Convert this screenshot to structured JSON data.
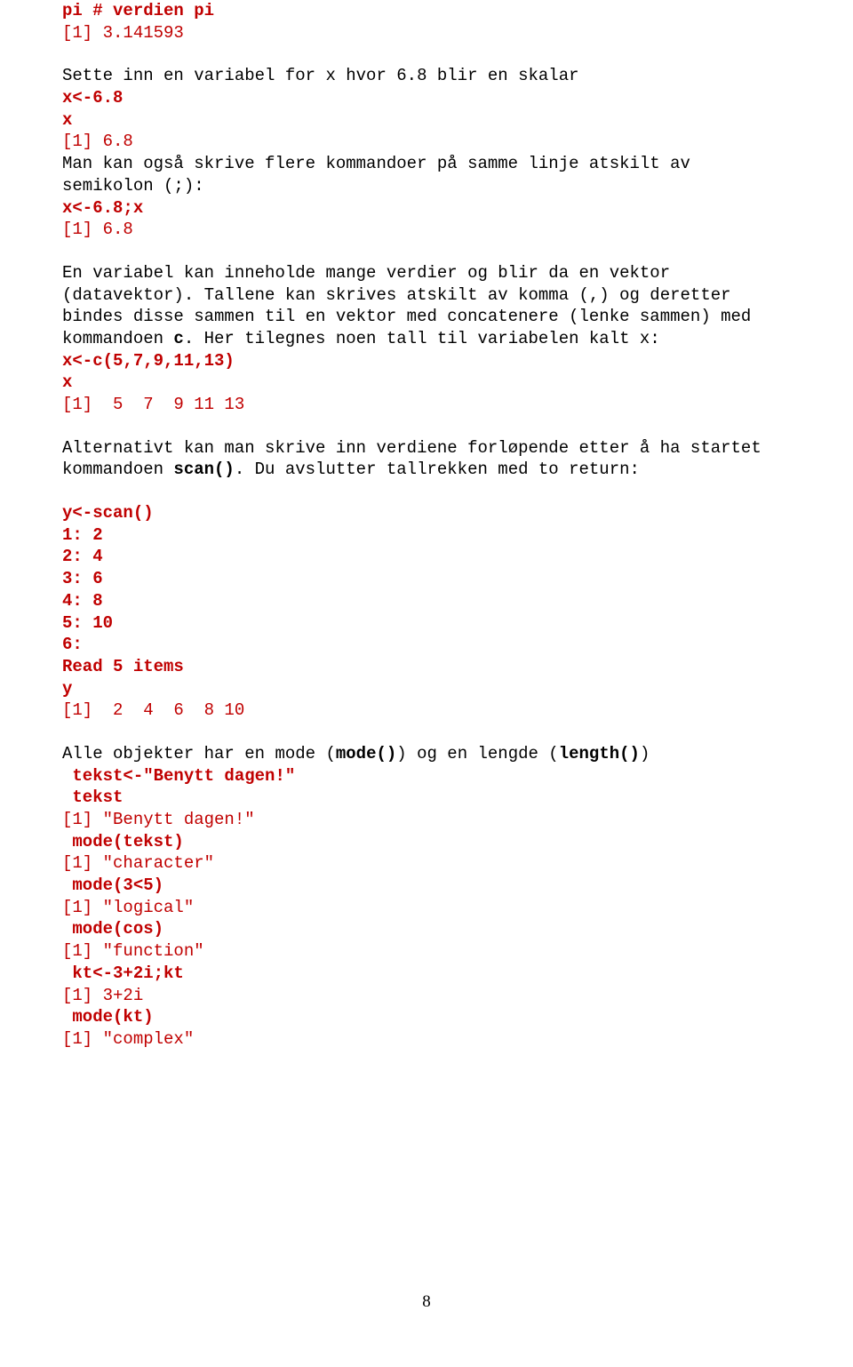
{
  "l1": "pi # verdien pi",
  "l2": "[1] 3.141593",
  "l3": "Sette inn en variabel for x hvor 6.8 blir en skalar",
  "l4": "x<-6.8",
  "l5": "x",
  "l6": "[1] 6.8",
  "l7": "Man kan også skrive flere kommandoer på samme linje atskilt av semikolon (;):",
  "l8": "x<-6.8;x",
  "l9": "[1] 6.8",
  "l10a": "En variabel kan inneholde mange verdier og blir da en vektor (datavektor). Tallene kan skrives atskilt av komma (,) og deretter bindes disse sammen til en vektor med concatenere (lenke sammen) med kommandoen ",
  "l10b": "c",
  "l10c": ". Her tilegnes noen tall til variabelen kalt x:",
  "l11": "x<-c(5,7,9,11,13)",
  "l12": "x",
  "l13": "[1]  5  7  9 11 13",
  "l14a": "Alternativt kan man skrive inn verdiene forløpende etter å ha startet kommandoen ",
  "l14b": "scan()",
  "l14c": ". Du avslutter tallrekken med to return:",
  "l15": "y<-scan()",
  "l16": "1: 2",
  "l17": "2: 4",
  "l18": "3: 6",
  "l19": "4: 8",
  "l20": "5: 10",
  "l21": "6:",
  "l22": "Read 5 items",
  "l23": "y",
  "l24": "[1]  2  4  6  8 10",
  "l25a": "Alle objekter har en mode (",
  "l25b": "mode()",
  "l25c": ") og en lengde (",
  "l25d": "length()",
  "l25e": ")",
  "l26": " tekst<-\"Benytt dagen!\"",
  "l27": " tekst",
  "l28": "[1] \"Benytt dagen!\"",
  "l29": " mode(tekst)",
  "l30": "[1] \"character\"",
  "l31": " mode(3<5)",
  "l32": "[1] \"logical\"",
  "l33": " mode(cos)",
  "l34": "[1] \"function\"",
  "l35": " kt<-3+2i;kt",
  "l36": "[1] 3+2i",
  "l37": " mode(kt)",
  "l38": "[1] \"complex\"",
  "pageno": "8"
}
